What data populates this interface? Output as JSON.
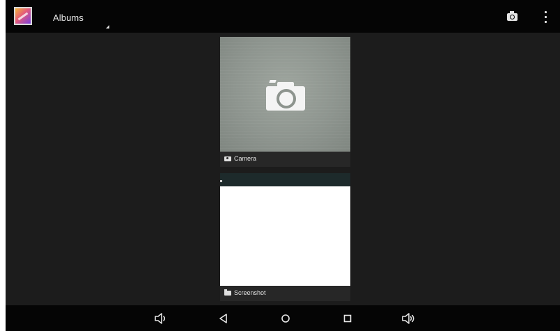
{
  "action_bar": {
    "app_icon": "gallery-app-icon",
    "spinner_label": "Albums",
    "actions": [
      {
        "name": "camera",
        "icon": "camera-icon"
      },
      {
        "name": "overflow",
        "icon": "overflow-menu-icon"
      }
    ]
  },
  "albums": [
    {
      "name": "Camera",
      "icon": "camera-icon",
      "count": ""
    },
    {
      "name": "Screenshot",
      "icon": "folder-icon",
      "count": ""
    }
  ],
  "nav_bar": {
    "buttons": [
      {
        "name": "volume-down",
        "icon": "volume-down-icon"
      },
      {
        "name": "back",
        "icon": "back-icon"
      },
      {
        "name": "home",
        "icon": "home-icon"
      },
      {
        "name": "recents",
        "icon": "recents-icon"
      },
      {
        "name": "volume-up",
        "icon": "volume-up-icon"
      }
    ]
  },
  "colors": {
    "background": "#1c1c1c",
    "bars": "#050505",
    "label_bar": "#282828",
    "icon": "#e6e6e6"
  }
}
